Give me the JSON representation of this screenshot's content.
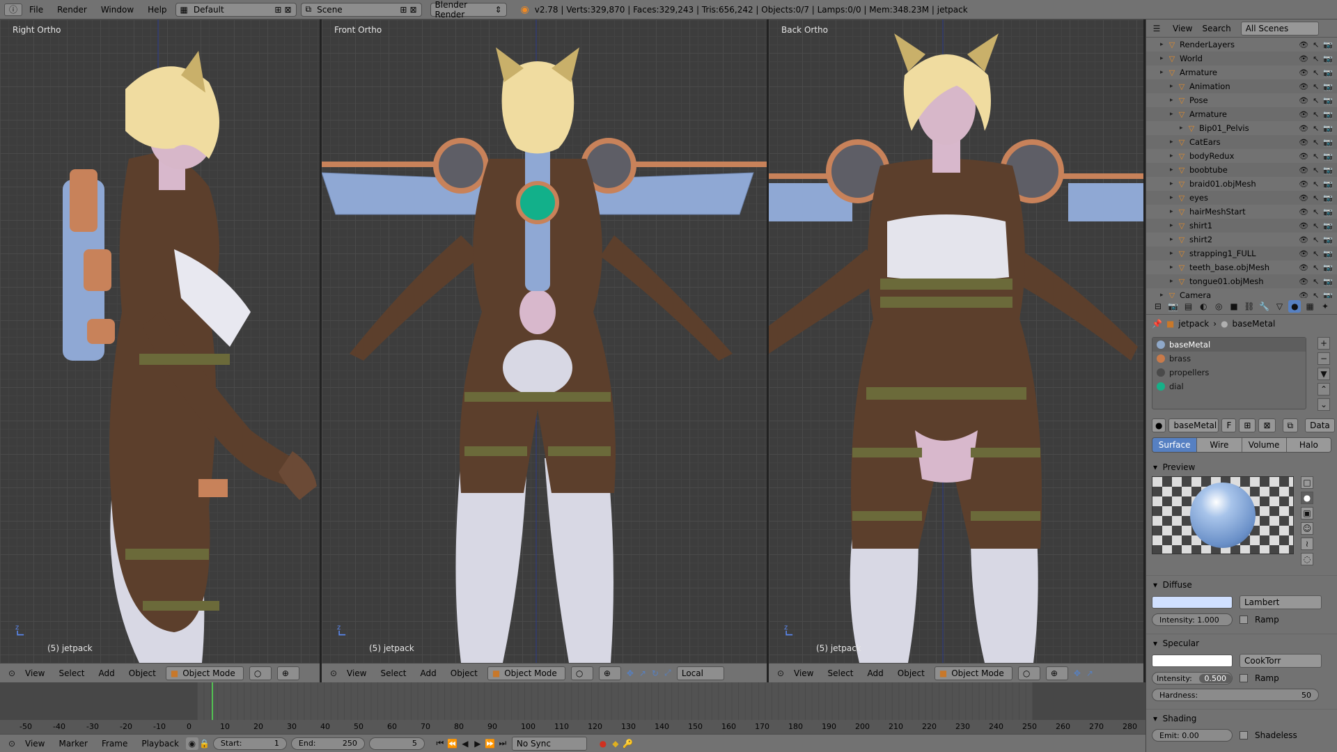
{
  "topbar": {
    "menus": [
      "File",
      "Render",
      "Window",
      "Help"
    ],
    "layout": "Default",
    "scene": "Scene",
    "engine": "Blender Render",
    "stats": "v2.78 | Verts:329,870 | Faces:329,243 | Tris:656,242 | Objects:0/7 | Lamps:0/0 | Mem:348.23M | jetpack"
  },
  "viewports": [
    {
      "label": "Right Ortho",
      "object": "(5) jetpack",
      "mode": "Object Mode",
      "menus": [
        "View",
        "Select",
        "Add",
        "Object"
      ]
    },
    {
      "label": "Front Ortho",
      "object": "(5) jetpack",
      "mode": "Object Mode",
      "menus": [
        "View",
        "Select",
        "Add",
        "Object"
      ],
      "orientation": "Local"
    },
    {
      "label": "Back Ortho",
      "object": "(5) jetpack",
      "mode": "Object Mode",
      "menus": [
        "View",
        "Select",
        "Add",
        "Object"
      ]
    }
  ],
  "outliner": {
    "menus": [
      "View",
      "Search"
    ],
    "filter": "All Scenes",
    "items": [
      {
        "label": "RenderLayers",
        "indent": 1
      },
      {
        "label": "World",
        "indent": 1
      },
      {
        "label": "Armature",
        "indent": 1
      },
      {
        "label": "Animation",
        "indent": 2
      },
      {
        "label": "Pose",
        "indent": 2
      },
      {
        "label": "Armature",
        "indent": 2
      },
      {
        "label": "Bip01_Pelvis",
        "indent": 3
      },
      {
        "label": "CatEars",
        "indent": 2
      },
      {
        "label": "bodyRedux",
        "indent": 2
      },
      {
        "label": "boobtube",
        "indent": 2
      },
      {
        "label": "braid01.objMesh",
        "indent": 2
      },
      {
        "label": "eyes",
        "indent": 2
      },
      {
        "label": "hairMeshStart",
        "indent": 2
      },
      {
        "label": "shirt1",
        "indent": 2
      },
      {
        "label": "shirt2",
        "indent": 2
      },
      {
        "label": "strapping1_FULL",
        "indent": 2
      },
      {
        "label": "teeth_base.objMesh",
        "indent": 2
      },
      {
        "label": "tongue01.objMesh",
        "indent": 2
      },
      {
        "label": "Camera",
        "indent": 1
      }
    ]
  },
  "properties": {
    "breadcrumb": [
      "jetpack",
      "baseMetal"
    ],
    "materials": [
      {
        "name": "baseMetal",
        "color": "#8fa8c8",
        "active": true
      },
      {
        "name": "brass",
        "color": "#c87a4a",
        "active": false
      },
      {
        "name": "propellers",
        "color": "#4a4a4a",
        "active": false
      },
      {
        "name": "dial",
        "color": "#16b088",
        "active": false
      }
    ],
    "material_name": "baseMetal",
    "fake_user": "F",
    "link": "Data",
    "tabs": [
      "Surface",
      "Wire",
      "Volume",
      "Halo"
    ],
    "active_tab": "Surface",
    "preview_title": "Preview",
    "diffuse_title": "Diffuse",
    "diffuse_shader": "Lambert",
    "diffuse_intensity": "Intensity:   1.000",
    "ramp": "Ramp",
    "specular_title": "Specular",
    "specular_shader": "CookTorr",
    "spec_intensity_label": "Intensity:",
    "spec_intensity": "0.500",
    "hardness_label": "Hardness:",
    "hardness": "50",
    "shading_title": "Shading",
    "emit": "Emit:          0.00",
    "shadeless": "Shadeless"
  },
  "timeline": {
    "ticks": [
      "-50",
      "-40",
      "-30",
      "-20",
      "-10",
      "0",
      "10",
      "20",
      "30",
      "40",
      "50",
      "60",
      "70",
      "80",
      "90",
      "100",
      "110",
      "120",
      "130",
      "140",
      "150",
      "160",
      "170",
      "180",
      "190",
      "200",
      "210",
      "220",
      "230",
      "240",
      "250",
      "260",
      "270",
      "280"
    ],
    "menus": [
      "View",
      "Marker",
      "Frame",
      "Playback"
    ],
    "start": "Start:",
    "start_val": "1",
    "end": "End:",
    "end_val": "250",
    "current": "5",
    "sync": "No Sync"
  }
}
